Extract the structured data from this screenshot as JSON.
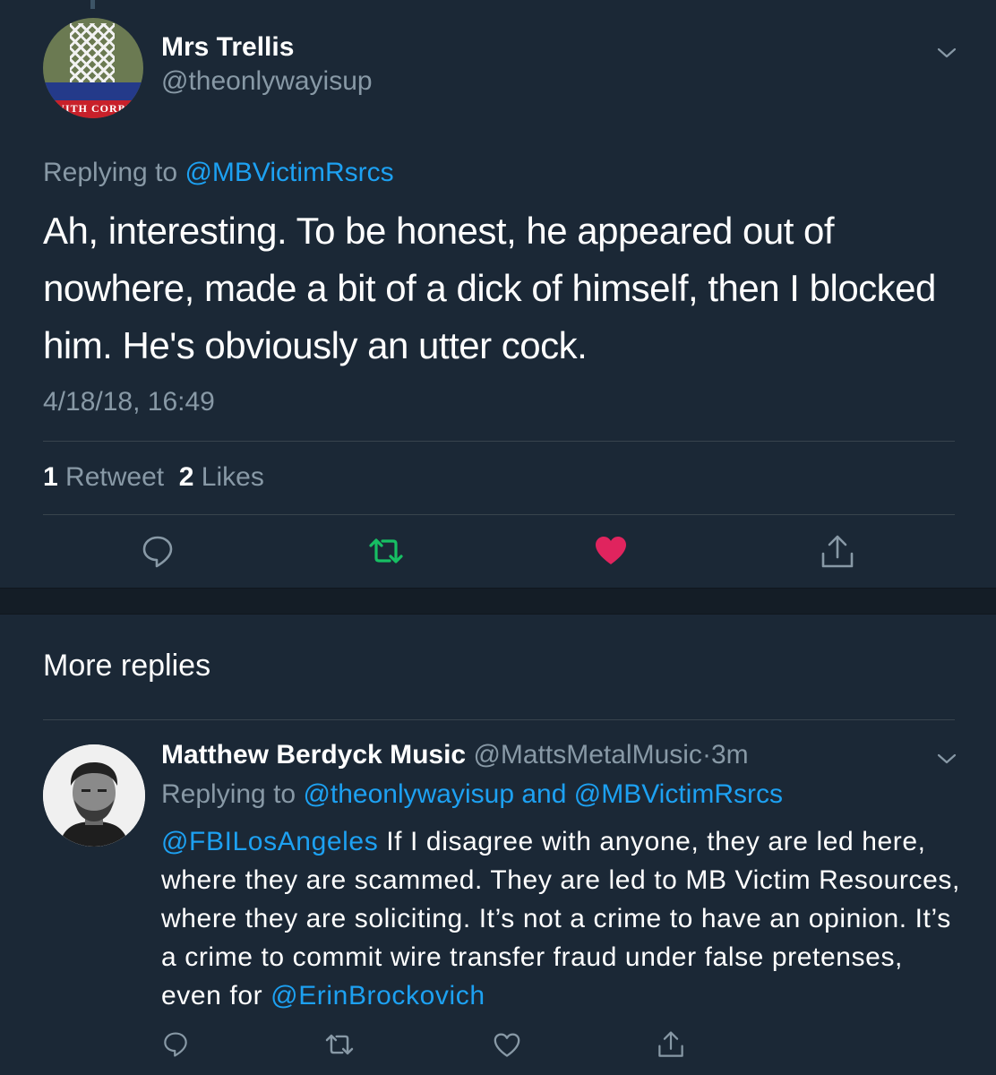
{
  "main_tweet": {
    "name": "Mrs Trellis",
    "handle": "@theonlywayisup",
    "avatar_text": "WITH CORBYN",
    "replying_prefix": "Replying to ",
    "replying_to": "@MBVictimRsrcs",
    "text": "Ah, interesting. To be honest, he appeared out of nowhere, made a bit of a dick of himself, then I blocked him. He's obviously an utter cock.",
    "timestamp": "4/18/18, 16:49",
    "retweet_count": "1",
    "retweet_label": "Retweet",
    "like_count": "2",
    "like_label": "Likes",
    "actions": {
      "reply_icon": "reply-icon",
      "retweet_icon": "retweet-icon",
      "like_icon": "heart-icon",
      "share_icon": "share-icon"
    },
    "retweeted": true,
    "liked": true
  },
  "section": {
    "title": "More replies"
  },
  "reply_tweet": {
    "name": "Matthew Berdyck Music",
    "handle": "@MattsMetalMusic",
    "separator": "·",
    "time": "3m",
    "replying_prefix": "Replying to ",
    "replying_to_1": "@theonlywayisup",
    "replying_and": " and ",
    "replying_to_2": "@MBVictimRsrcs",
    "mention_start": "@FBILosAngeles",
    "text_body": " If I disagree with anyone, they are led here, where they are scammed. They are led to MB Victim Resources, where they are soliciting. It’s not a crime to have an opinion. It’s a crime to commit wire transfer fraud under false pretenses, even for ",
    "mention_end": "@ErinBrockovich"
  },
  "colors": {
    "background": "#1b2836",
    "text_secondary": "#8899a6",
    "link": "#1da1f2",
    "retweet_active": "#17bf63",
    "like_active": "#e0245e",
    "divider": "#38444d"
  }
}
